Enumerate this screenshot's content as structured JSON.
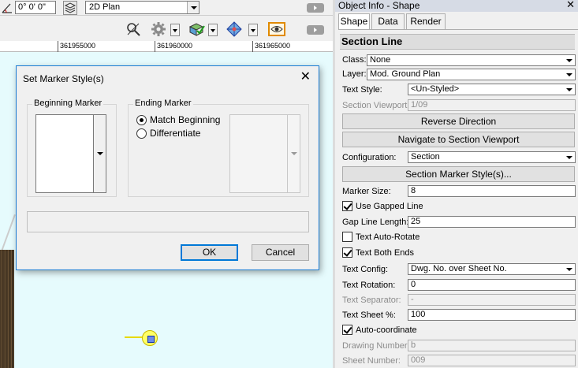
{
  "toolbar": {
    "angle_value": "0° 0' 0\"",
    "view_value": "2D Plan"
  },
  "ruler": {
    "labels": [
      "361955000",
      "361960000",
      "361965000"
    ]
  },
  "dialog": {
    "title": "Set Marker Style(s)",
    "beginning_label": "Beginning Marker",
    "ending_label": "Ending Marker",
    "radio_match": "Match Beginning",
    "radio_differentiate": "Differentiate",
    "ok_label": "OK",
    "cancel_label": "Cancel"
  },
  "oip": {
    "title": "Object Info - Shape",
    "tabs": [
      "Shape",
      "Data",
      "Render"
    ],
    "object_type": "Section Line",
    "class_label": "Class:",
    "class_value": "None",
    "layer_label": "Layer:",
    "layer_value": "Mod. Ground Plan",
    "text_style_label": "Text Style:",
    "text_style_value": "<Un-Styled>",
    "section_viewport_label": "Section Viewport:",
    "section_viewport_value": "1/09",
    "reverse_direction": "Reverse Direction",
    "navigate_viewport": "Navigate to Section Viewport",
    "configuration_label": "Configuration:",
    "configuration_value": "Section",
    "marker_styles_button": "Section Marker Style(s)...",
    "marker_size_label": "Marker Size:",
    "marker_size_value": "8",
    "use_gapped_line": "Use Gapped Line",
    "gap_line_length_label": "Gap Line Length:",
    "gap_line_length_value": "25",
    "text_auto_rotate": "Text Auto-Rotate",
    "text_both_ends": "Text Both Ends",
    "text_config_label": "Text Config:",
    "text_config_value": "Dwg. No. over Sheet No.",
    "text_rotation_label": "Text Rotation:",
    "text_rotation_value": "0",
    "text_separator_label": "Text Separator:",
    "text_separator_value": "-",
    "text_sheet_label": "Text Sheet %:",
    "text_sheet_value": "100",
    "auto_coordinate": "Auto-coordinate",
    "drawing_number_label": "Drawing Number:",
    "drawing_number_value": "b",
    "sheet_number_label": "Sheet Number:",
    "sheet_number_value": "009"
  },
  "colors": {
    "canvas_bg": "#e6fbfd",
    "dialog_border": "#1b7cd4",
    "default_button": "#0078d7",
    "marker_highlight": "#ffff66"
  }
}
